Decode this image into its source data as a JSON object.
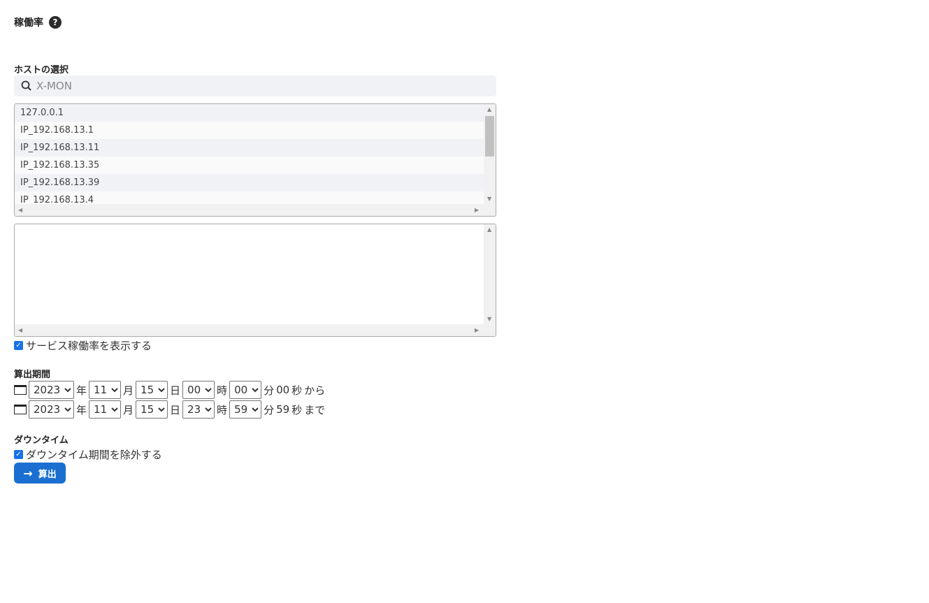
{
  "title": "稼働率",
  "help_icon": "?",
  "host_section": {
    "label": "ホストの選択",
    "search_value": "X-MON",
    "hosts": [
      "127.0.0.1",
      "IP_192.168.13.1",
      "IP_192.168.13.11",
      "IP_192.168.13.35",
      "IP_192.168.13.39",
      "IP_192.168.13.4"
    ]
  },
  "show_service": {
    "label": "サービス稼働率を表示する",
    "checked": true
  },
  "period": {
    "label": "算出期間",
    "from": {
      "year": "2023",
      "month": "11",
      "day": "15",
      "hour": "00",
      "minute": "00",
      "second": "00",
      "suffix": "から"
    },
    "to": {
      "year": "2023",
      "month": "11",
      "day": "15",
      "hour": "23",
      "minute": "59",
      "second": "59",
      "suffix": "まで"
    },
    "units": {
      "year": "年",
      "month": "月",
      "day": "日",
      "hour": "時",
      "minute": "分",
      "second": "秒"
    }
  },
  "downtime": {
    "label": "ダウンタイム",
    "checkbox_label": "ダウンタイム期間を除外する",
    "checked": true
  },
  "submit": {
    "label": "算出",
    "icon": "→"
  },
  "colors": {
    "accent": "#1a6fd0"
  }
}
